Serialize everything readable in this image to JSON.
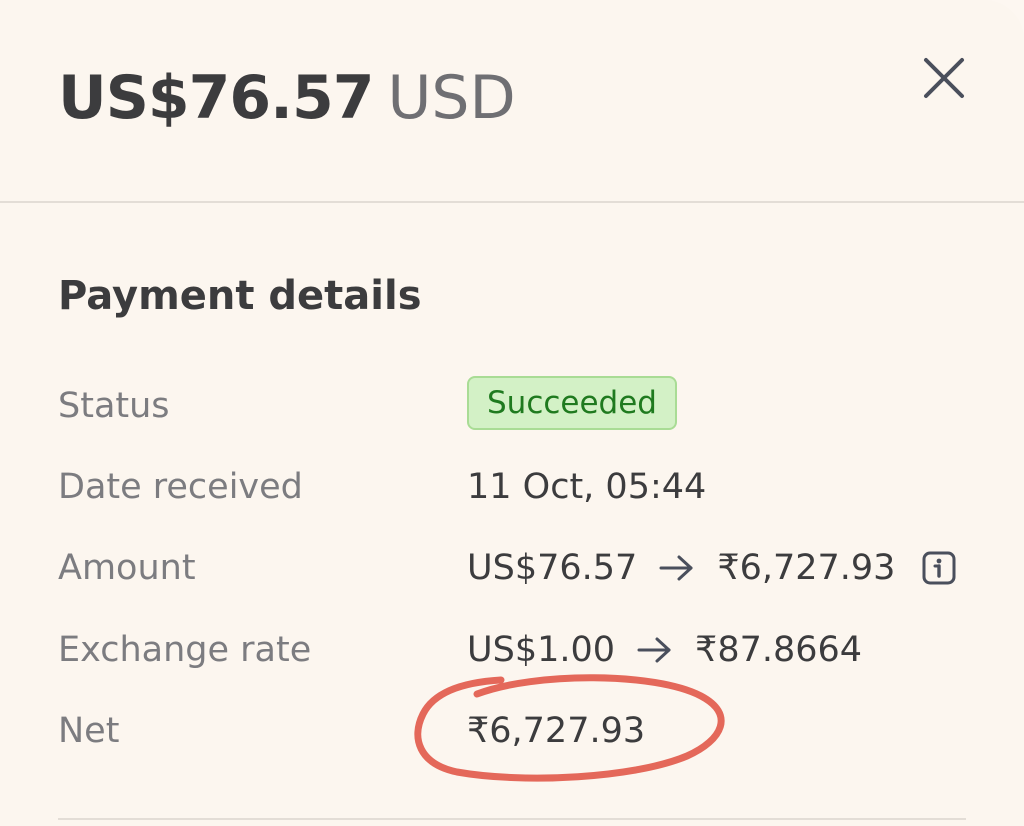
{
  "header": {
    "amount": "US$76.57",
    "currency": "USD",
    "close_icon": "close-icon"
  },
  "payment_details": {
    "title": "Payment details",
    "rows": [
      {
        "label": "Status",
        "value": "Succeeded",
        "kind": "badge"
      },
      {
        "label": "Date received",
        "value": "11 Oct, 05:44"
      },
      {
        "label": "Amount",
        "from": "US$76.57",
        "to": "₹6,727.93",
        "icon": "info-icon"
      },
      {
        "label": "Exchange rate",
        "from": "US$1.00",
        "to": "₹87.8664"
      },
      {
        "label": "Net",
        "value": "₹6,727.93",
        "annotation": "hand-drawn-circle"
      }
    ]
  },
  "colors": {
    "background": "#fcf6ef",
    "text_primary": "#3c3c3e",
    "text_secondary": "#7c7c80",
    "badge_bg": "#d3f1c6",
    "badge_text": "#1f7a1f",
    "annotation": "#e4685a"
  }
}
